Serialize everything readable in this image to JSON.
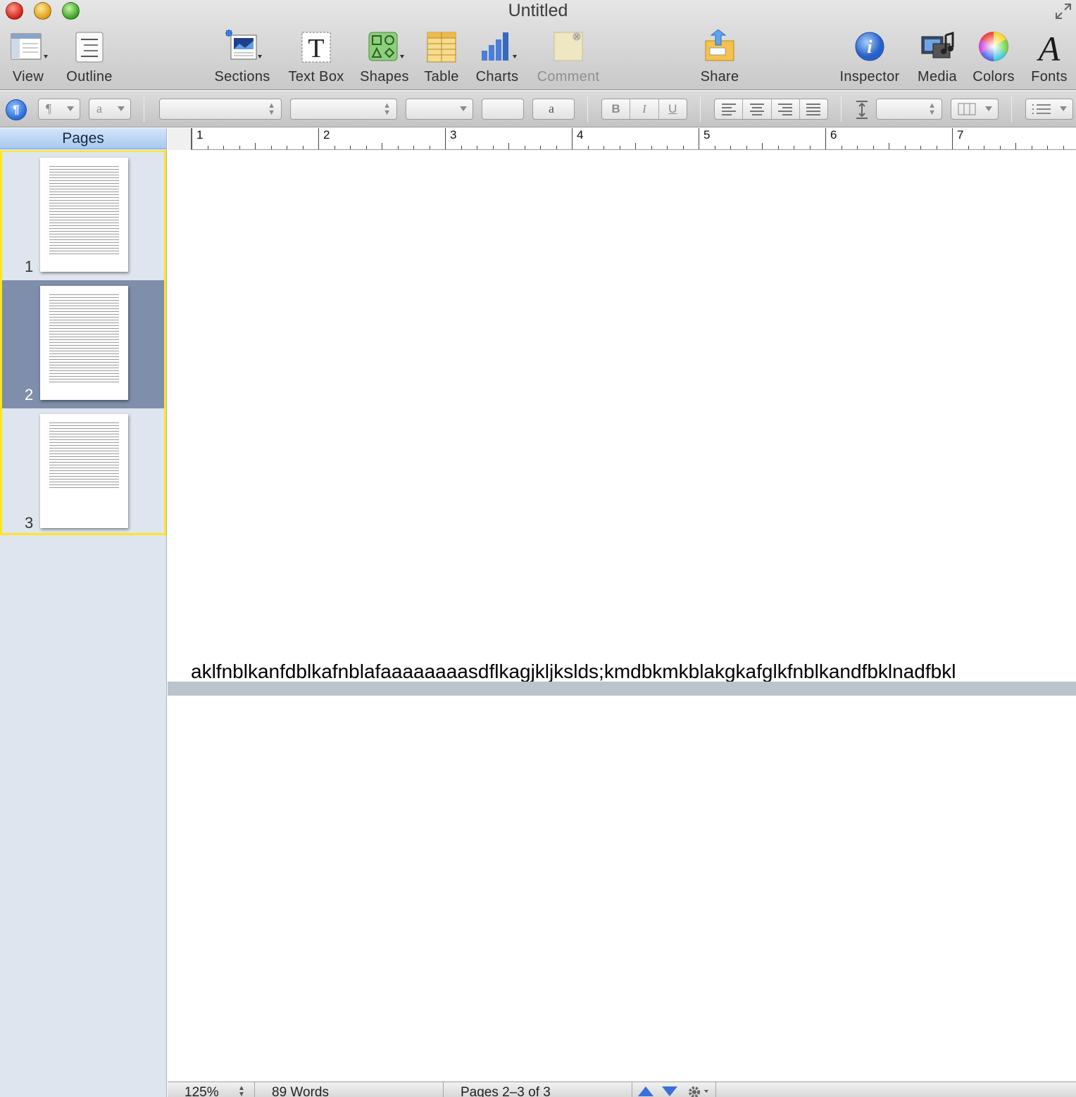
{
  "window": {
    "title": "Untitled"
  },
  "toolbar": {
    "view": "View",
    "outline": "Outline",
    "sections": "Sections",
    "text_box": "Text Box",
    "shapes": "Shapes",
    "table": "Table",
    "charts": "Charts",
    "comment": "Comment",
    "share": "Share",
    "inspector": "Inspector",
    "media": "Media",
    "colors": "Colors",
    "fonts": "Fonts"
  },
  "formatbar": {
    "paragraph_style_glyph": "¶",
    "character_style_glyph": "a",
    "text_color_glyph": "a",
    "bold": "B",
    "italic": "I",
    "underline": "U"
  },
  "sidebar": {
    "header": "Pages",
    "pages": [
      {
        "number": "1"
      },
      {
        "number": "2"
      },
      {
        "number": "3"
      }
    ]
  },
  "ruler": {
    "labels": [
      "1",
      "2",
      "3",
      "4",
      "5",
      "6",
      "7"
    ]
  },
  "document": {
    "text": "aklfnblkanfdblkafnblafaaaaaaaasdflkagjkljkslds;kmdbkmkblakgkafglkfnblkandfbklnadfbkl"
  },
  "status": {
    "zoom": "125%",
    "word_count": "89 Words",
    "page_info": "Pages 2–3 of 3"
  }
}
